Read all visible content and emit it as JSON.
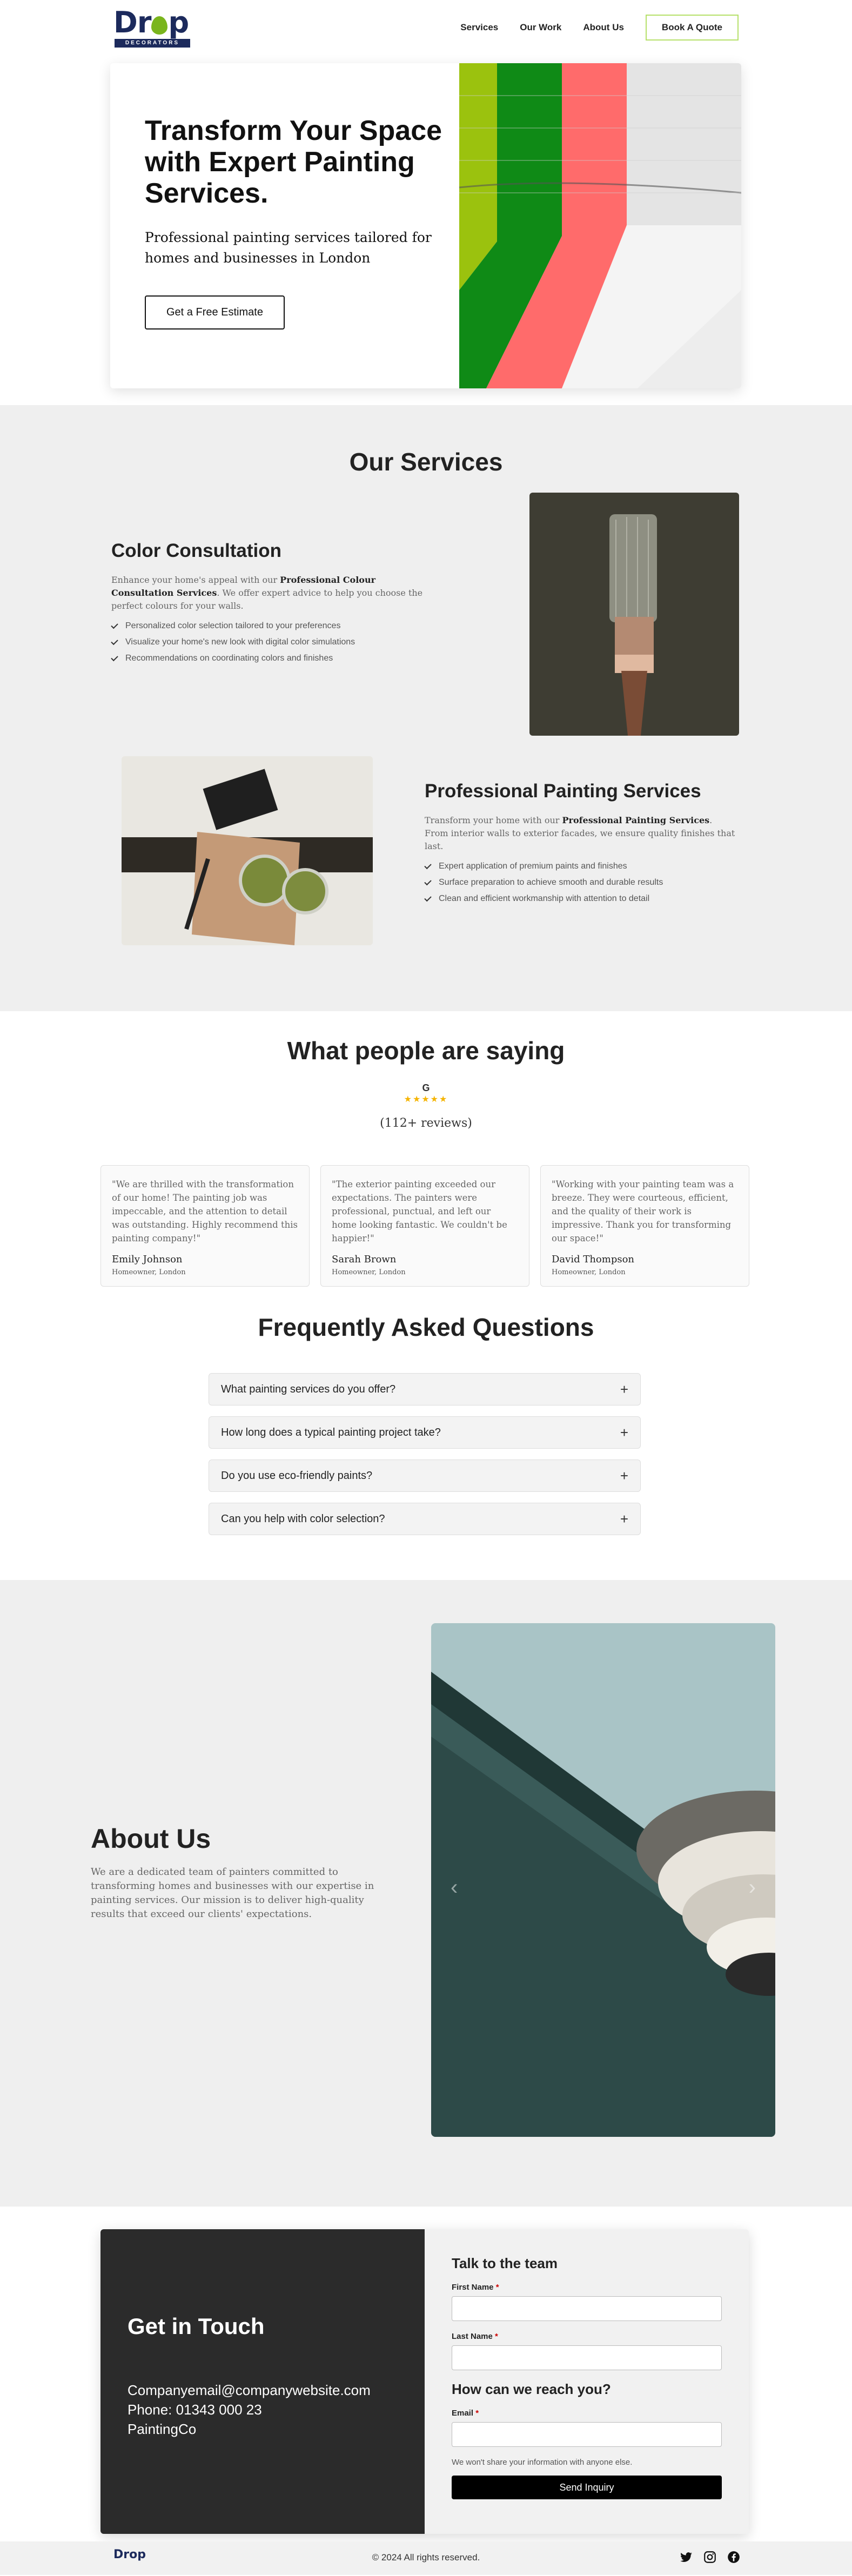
{
  "nav": {
    "logo_text": "Drop",
    "logo_sub": "DECORATORS",
    "links": [
      "Services",
      "Our Work",
      "About Us"
    ],
    "cta": "Book A Quote"
  },
  "hero": {
    "title": "Transform Your Space with Expert Painting Services.",
    "subtitle": "Professional painting services tailored for homes and businesses in London",
    "button": "Get a Free Estimate"
  },
  "services": {
    "title": "Our Services",
    "items": [
      {
        "title": "Color Consultation",
        "desc_pre": "Enhance your home's appeal with our ",
        "desc_bold": "Professional Colour Consultation Services",
        "desc_post": ". We offer expert advice to help you choose the perfect colours for your walls.",
        "bullets": [
          "Personalized color selection tailored to your preferences",
          "Visualize your home's new look with digital color simulations",
          "Recommendations on coordinating colors and finishes"
        ]
      },
      {
        "title": "Professional Painting Services",
        "desc_pre": "Transform your home with our ",
        "desc_bold": "Professional Painting Services",
        "desc_post": ". From interior walls to exterior facades, we ensure quality finishes that last.",
        "bullets": [
          "Expert application of premium paints and finishes",
          "Surface preparation to achieve smooth and durable results",
          "Clean and efficient workmanship with attention to detail"
        ]
      }
    ]
  },
  "testimonials": {
    "title": "What people are saying",
    "google_mark": "G",
    "stars": "★★★★★",
    "reviews": "(112+ reviews)",
    "items": [
      {
        "quote": "\"We are thrilled with the transformation of our home! The painting job was impeccable, and the attention to detail was outstanding. Highly recommend this painting company!\"",
        "name": "Emily Johnson",
        "role": "Homeowner, London"
      },
      {
        "quote": "\"The exterior painting exceeded our expectations. The painters were professional, punctual, and left our home looking fantastic. We couldn't be happier!\"",
        "name": "Sarah Brown",
        "role": "Homeowner, London"
      },
      {
        "quote": "\"Working with your painting team was a breeze. They were courteous, efficient, and the quality of their work is impressive. Thank you for transforming our space!\"",
        "name": "David Thompson",
        "role": "Homeowner, London"
      }
    ]
  },
  "faq": {
    "title": "Frequently Asked Questions",
    "items": [
      "What painting services do you offer?",
      "How long does a typical painting project take?",
      "Do you use eco-friendly paints?",
      "Can you help with color selection?"
    ],
    "toggle": "+"
  },
  "about": {
    "title": "About Us",
    "text": "We are a dedicated team of painters committed to transforming homes and businesses with our expertise in painting services. Our mission is to deliver high-quality results that exceed our clients' expectations.",
    "prev": "‹",
    "next": "›"
  },
  "contact": {
    "title": "Get in Touch",
    "email": "Companyemail@companywebsite.com",
    "phone": "Phone: 01343 000 23",
    "company": "PaintingCo",
    "form_title": "Talk to the team",
    "first_name": "First Name",
    "last_name": "Last Name",
    "reach_title": "How can we reach you?",
    "email_label": "Email",
    "required": "*",
    "note": "We won't share your information with anyone else.",
    "submit": "Send Inquiry"
  },
  "footer": {
    "logo": "Drop",
    "copyright": "© 2024 All rights reserved."
  }
}
